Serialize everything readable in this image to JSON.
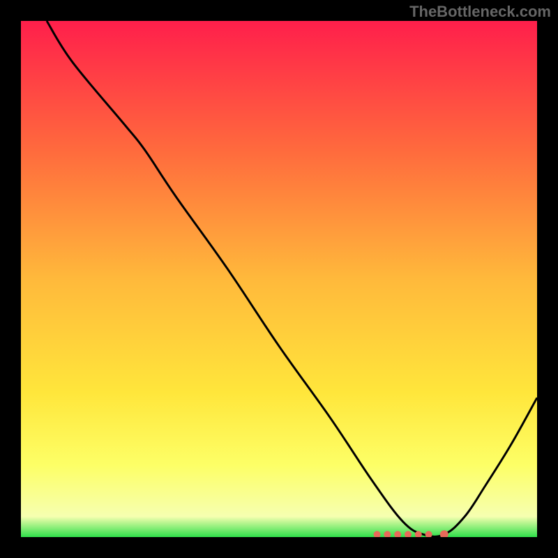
{
  "watermark": "TheBottleneck.com",
  "chart_data": {
    "type": "line",
    "title": "",
    "xlabel": "",
    "ylabel": "",
    "xlim": [
      0,
      100
    ],
    "ylim": [
      0,
      100
    ],
    "gradient_stops": [
      {
        "offset": 0,
        "color": "#ff1f4b"
      },
      {
        "offset": 25,
        "color": "#ff6a3d"
      },
      {
        "offset": 50,
        "color": "#ffb93b"
      },
      {
        "offset": 72,
        "color": "#ffe63b"
      },
      {
        "offset": 86,
        "color": "#fdff66"
      },
      {
        "offset": 96,
        "color": "#f6ffb0"
      },
      {
        "offset": 100,
        "color": "#2fe04a"
      }
    ],
    "series": [
      {
        "name": "bottleneck-curve",
        "x": [
          5,
          10,
          20,
          24,
          30,
          40,
          50,
          60,
          68,
          74,
          78,
          82,
          86,
          90,
          95,
          100
        ],
        "y": [
          100,
          92,
          80,
          75,
          66,
          52,
          37,
          23,
          11,
          3,
          0.5,
          0.5,
          4,
          10,
          18,
          27
        ]
      }
    ],
    "markers": {
      "name": "highlight-points",
      "x": [
        69,
        71,
        73,
        75,
        77,
        79,
        82
      ],
      "y": [
        0.5,
        0.5,
        0.5,
        0.5,
        0.5,
        0.5,
        0.5
      ]
    }
  }
}
